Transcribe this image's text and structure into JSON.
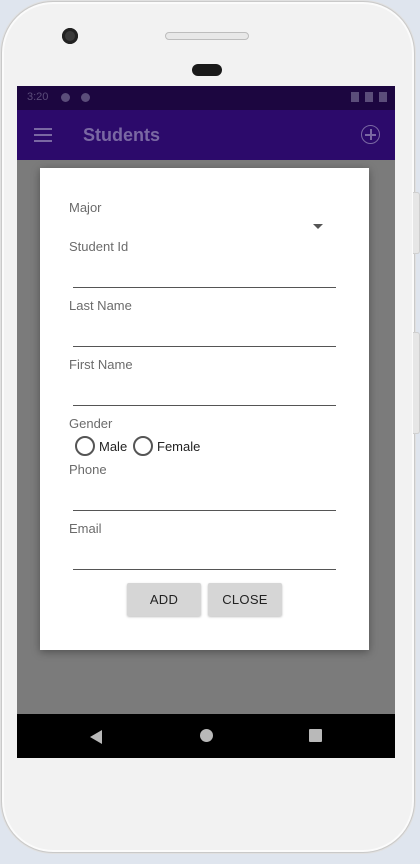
{
  "status_bar": {
    "time": "3:20"
  },
  "app_bar": {
    "title": "Students"
  },
  "dialog": {
    "major_label": "Major",
    "student_id_label": "Student Id",
    "last_name_label": "Last Name",
    "first_name_label": "First Name",
    "gender_label": "Gender",
    "gender_options": [
      "Male",
      "Female"
    ],
    "phone_label": "Phone",
    "email_label": "Email",
    "add_button": "ADD",
    "close_button": "CLOSE"
  },
  "icons": [
    "menu-icon",
    "add-circle-icon",
    "nav-back-icon",
    "nav-home-icon",
    "nav-recents-icon",
    "dropdown-arrow-icon"
  ],
  "colors": {
    "app_bar": "#2c0a6b",
    "status_bar": "#1c0640",
    "scrim": "#7b7b7b",
    "button": "#d6d6d6"
  }
}
